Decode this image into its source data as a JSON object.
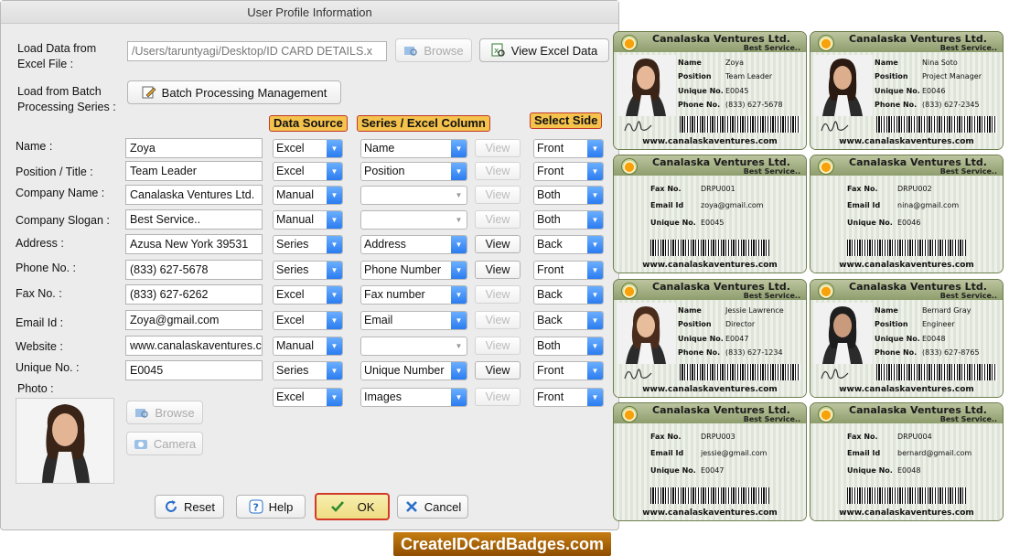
{
  "dialog": {
    "title": "User Profile Information"
  },
  "excel": {
    "label": "Load Data from Excel File :",
    "path": "/Users/taruntyagi/Desktop/ID CARD DETAILS.x",
    "browse": "Browse",
    "view_excel": "View Excel Data"
  },
  "batch": {
    "label": "Load from Batch Processing Series :",
    "button": "Batch Processing Management"
  },
  "headers": {
    "data_source": "Data Source",
    "series_col": "Series / Excel Column",
    "select_side": "Select Side"
  },
  "view_label": "View",
  "fields": [
    {
      "label": "Name :",
      "value": "Zoya",
      "source": "Excel",
      "column": "Name",
      "view_enabled": false,
      "side": "Front"
    },
    {
      "label": "Position / Title :",
      "value": "Team Leader",
      "source": "Excel",
      "column": "Position",
      "view_enabled": false,
      "side": "Front"
    },
    {
      "label": "Company Name :",
      "value": "Canalaska Ventures Ltd.",
      "source": "Manual",
      "column": "",
      "view_enabled": false,
      "side": "Both"
    },
    {
      "label": "Company Slogan :",
      "value": "Best Service..",
      "source": "Manual",
      "column": "",
      "view_enabled": false,
      "side": "Both"
    },
    {
      "label": "Address :",
      "value": "Azusa New York 39531",
      "source": "Series",
      "column": "Address",
      "view_enabled": true,
      "side": "Back"
    },
    {
      "label": "Phone No. :",
      "value": "(833) 627-5678",
      "source": "Series",
      "column": "Phone Number",
      "view_enabled": true,
      "side": "Front"
    },
    {
      "label": "Fax No. :",
      "value": "(833) 627-6262",
      "source": "Excel",
      "column": "Fax number",
      "view_enabled": false,
      "side": "Back"
    },
    {
      "label": "Email Id :",
      "value": "Zoya@gmail.com",
      "source": "Excel",
      "column": "Email",
      "view_enabled": false,
      "side": "Back"
    },
    {
      "label": "Website :",
      "value": "www.canalaskaventures.c",
      "source": "Manual",
      "column": "",
      "view_enabled": false,
      "side": "Both"
    },
    {
      "label": "Unique No. :",
      "value": "E0045",
      "source": "Series",
      "column": "Unique Number",
      "view_enabled": true,
      "side": "Front"
    }
  ],
  "photo": {
    "label": "Photo :",
    "source": "Excel",
    "column": "Images",
    "side": "Front",
    "browse": "Browse",
    "camera": "Camera"
  },
  "buttons": {
    "reset": "Reset",
    "help": "Help",
    "ok": "OK",
    "cancel": "Cancel"
  },
  "cards": {
    "company": "Canalaska Ventures Ltd.",
    "slogan": "Best Service..",
    "url": "www.canalaskaventures.com",
    "front_labels": {
      "name": "Name",
      "position": "Position",
      "unique": "Unique No.",
      "phone": "Phone No."
    },
    "back_labels": {
      "fax": "Fax No.",
      "email": "Email Id",
      "unique": "Unique No."
    },
    "people": [
      {
        "name": "Zoya",
        "position": "Team Leader",
        "unique": "E0045",
        "phone": "(833) 627-5678",
        "fax": "DRPU001",
        "email": "zoya@gmail.com"
      },
      {
        "name": "Nina Soto",
        "position": "Project Manager",
        "unique": "E0046",
        "phone": "(833) 627-2345",
        "fax": "DRPU002",
        "email": "nina@gmail.com"
      },
      {
        "name": "Jessie Lawrence",
        "position": "Director",
        "unique": "E0047",
        "phone": "(833) 627-1234",
        "fax": "DRPU003",
        "email": "jessie@gmail.com"
      },
      {
        "name": "Bernard Gray",
        "position": "Engineer",
        "unique": "E0048",
        "phone": "(833) 627-8765",
        "fax": "DRPU004",
        "email": "bernard@gmail.com"
      }
    ]
  },
  "brand": "CreateIDCardBadges.com",
  "colors": {
    "header_fill": "#f5c24c",
    "header_border": "#c0392b",
    "select_arrow": "#2b7cf0",
    "ok_fill": "#f3e69a",
    "card_band": "#a3af83",
    "brand_fill": "#a76400"
  }
}
